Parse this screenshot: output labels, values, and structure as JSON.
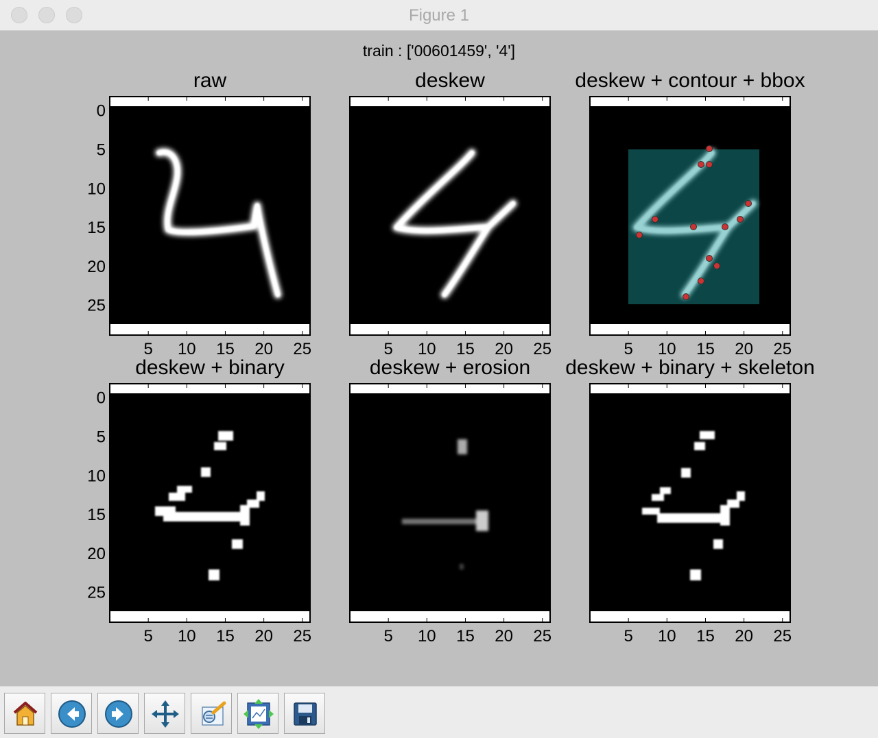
{
  "window": {
    "title": "Figure 1"
  },
  "figure": {
    "suptitle": "train : ['00601459', '4']",
    "panels": [
      {
        "title": "raw"
      },
      {
        "title": "deskew"
      },
      {
        "title": "deskew + contour + bbox"
      },
      {
        "title": "deskew + binary"
      },
      {
        "title": "deskew + erosion"
      },
      {
        "title": "deskew + binary + skeleton"
      }
    ],
    "x_ticks": [
      "5",
      "10",
      "15",
      "20",
      "25"
    ],
    "y_ticks": [
      "0",
      "5",
      "10",
      "15",
      "20",
      "25"
    ]
  },
  "colors": {
    "figure_bg": "#bfbfbf",
    "bbox_fill": "#1a9c9c",
    "contour_point": "#cc3333"
  },
  "toolbar": {
    "buttons": [
      "home-icon",
      "back-icon",
      "forward-icon",
      "pan-icon",
      "subplots-icon",
      "configure-icon",
      "save-icon"
    ]
  }
}
